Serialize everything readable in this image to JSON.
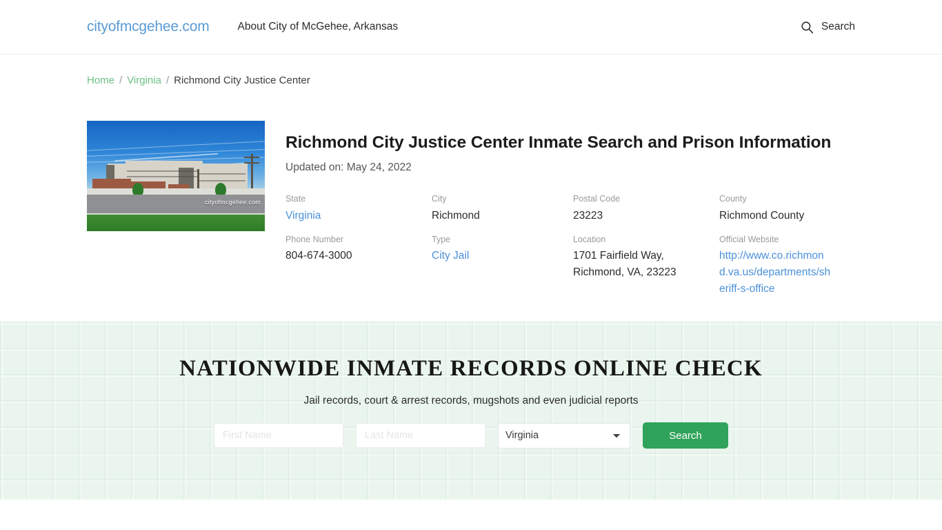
{
  "header": {
    "brand": "cityofmcgehee.com",
    "nav_items": [
      {
        "label": "About City of McGehee, Arkansas"
      }
    ],
    "search_label": "Search",
    "search_icon": "search-icon"
  },
  "breadcrumb": {
    "home": "Home",
    "state": "Virginia",
    "current": "Richmond City Justice Center",
    "separator": "/"
  },
  "facility": {
    "title": "Richmond City Justice Center Inmate Search and Prison Information",
    "updated": "Updated on: May 24, 2022",
    "image_watermark": "cityofmcgehee.com",
    "facts": [
      {
        "label": "State",
        "value": "Virginia",
        "is_link": true
      },
      {
        "label": "City",
        "value": "Richmond",
        "is_link": false
      },
      {
        "label": "Postal Code",
        "value": "23223",
        "is_link": false
      },
      {
        "label": "County",
        "value": "Richmond County",
        "is_link": false
      },
      {
        "label": "Phone Number",
        "value": "804-674-3000",
        "is_link": false
      },
      {
        "label": "Type",
        "value": "City Jail",
        "is_link": true
      },
      {
        "label": "Location",
        "value": "1701 Fairfield Way, Richmond, VA, 23223",
        "is_link": false
      },
      {
        "label": "Official Website",
        "value": "http://www.co.richmond.va.us/departments/sheriff-s-office",
        "is_link": true
      }
    ]
  },
  "promo": {
    "title": "Nationwide Inmate Records Online Check",
    "subtitle": "Jail records, court & arrest records, mugshots and even judicial reports",
    "first_name_placeholder": "First Name",
    "first_name_value": "",
    "last_name_placeholder": "Last Name",
    "last_name_value": "",
    "state_selected": "Virginia",
    "state_options": [
      "Virginia"
    ],
    "submit_label": "Search",
    "accent_color": "#2fa35a",
    "background_color": "#eaf5ee"
  }
}
